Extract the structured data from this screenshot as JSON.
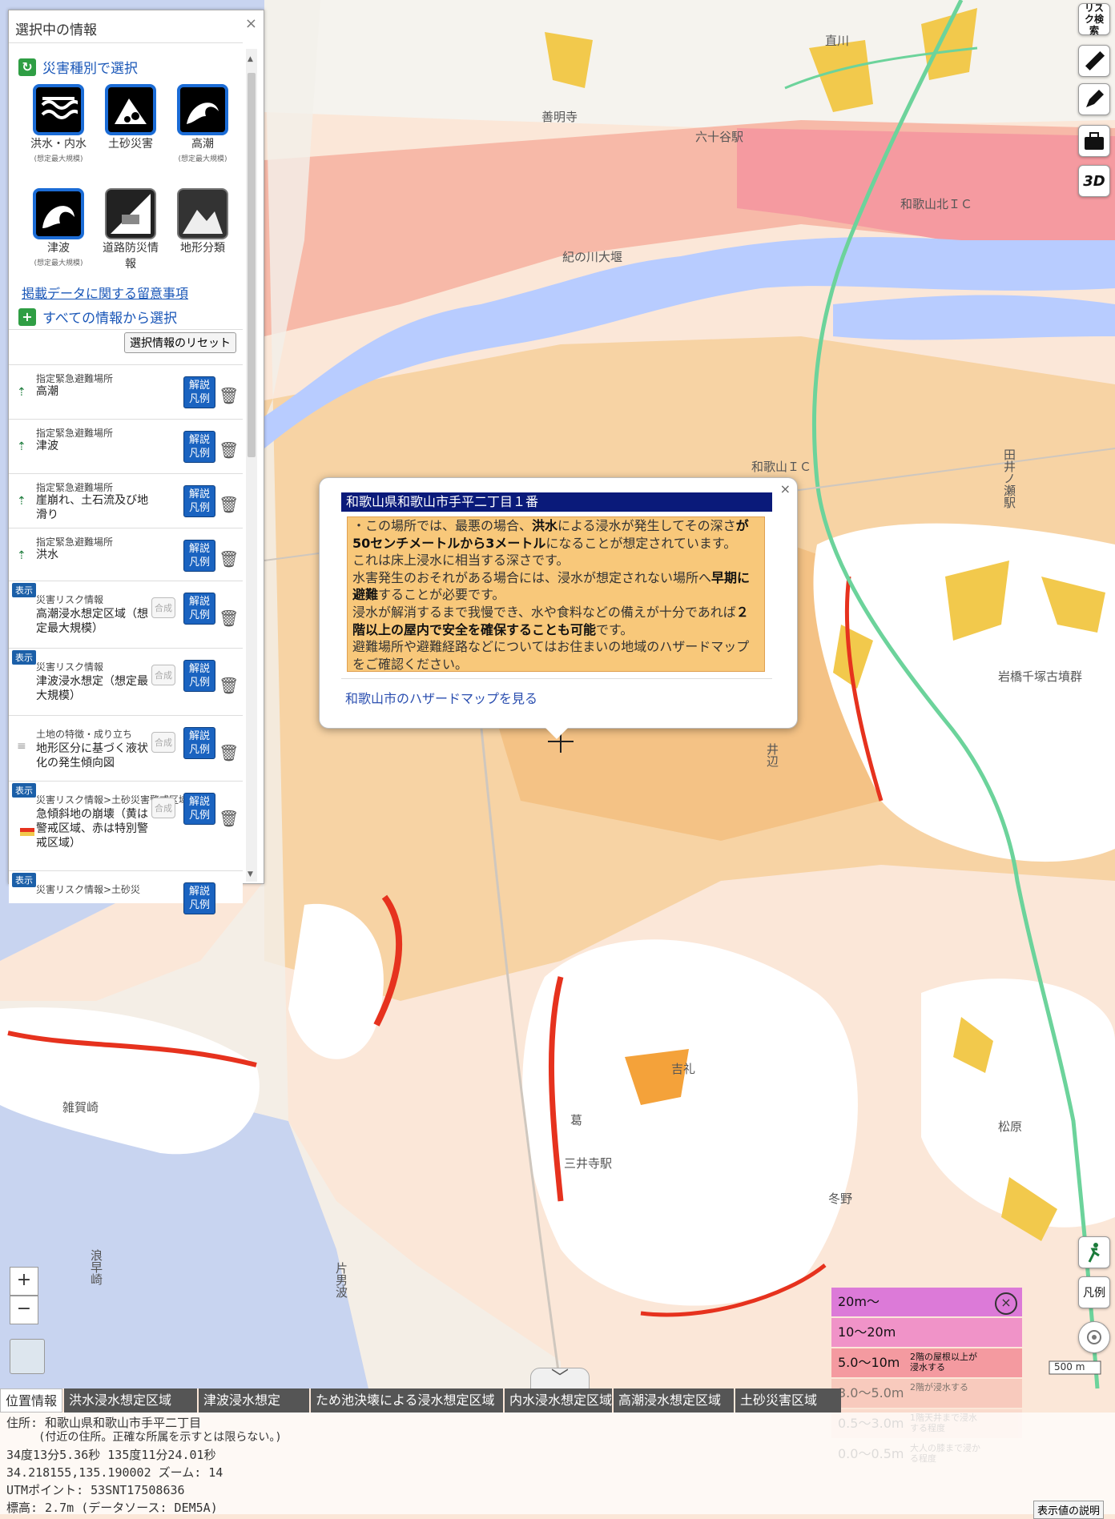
{
  "map": {
    "place_labels": [
      {
        "text": "直川"
      },
      {
        "text": "善明寺"
      },
      {
        "text": "六十谷駅"
      },
      {
        "text": "和歌山北ＩＣ"
      },
      {
        "text": "紀の川大堰"
      },
      {
        "text": "和歌山ＩＣ"
      },
      {
        "text": "岩橋千塚古墳群"
      },
      {
        "text": "吉礼"
      },
      {
        "text": "葛"
      },
      {
        "text": "三井寺駅"
      },
      {
        "text": "松原"
      },
      {
        "text": "冬野"
      },
      {
        "text": "雑賀崎"
      },
      {
        "text": "片男波"
      },
      {
        "text": "浪早崎"
      },
      {
        "text": "井辺"
      },
      {
        "text": "田井ノ瀬駅"
      }
    ],
    "scale_label": "500 m",
    "colors": {
      "base": "#fbe7d8",
      "flood_pink": "#f7b9a8",
      "flood_deep": "#f59aa0",
      "tsunami_yellow": "#f7e37a",
      "orange": "#f4b45c",
      "landslide_red": "#e6321e",
      "white_hill": "#ffffff",
      "river": "#b8ccff",
      "sea": "#c8d4f0",
      "expressway": "#6cd39b"
    }
  },
  "panel": {
    "title": "選択中の情報",
    "close": "×",
    "hazard_section": "災害種別で選択",
    "hazards": [
      {
        "label": "洪水・内水",
        "sub": "(想定最大規模)",
        "icon": "flood-icon"
      },
      {
        "label": "土砂災害",
        "sub": "",
        "icon": "landslide-icon"
      },
      {
        "label": "高潮",
        "sub": "(想定最大規模)",
        "icon": "storm-surge-icon"
      },
      {
        "label": "津波",
        "sub": "(想定最大規模)",
        "icon": "tsunami-icon"
      },
      {
        "label": "道路防災情報",
        "sub": "",
        "icon": "road-disaster-icon"
      },
      {
        "label": "地形分類",
        "sub": "",
        "icon": "terrain-icon"
      }
    ],
    "notes_link": "掲載データに関する留意事項",
    "all_info": "すべての情報から選択",
    "reset": "選択情報のリセット",
    "legend_btn_1": "解説",
    "legend_btn_2": "凡例",
    "merge_label": "合成",
    "show_badge": "表示",
    "items": [
      {
        "cat": "指定緊急避難場所",
        "name": "高潮"
      },
      {
        "cat": "指定緊急避難場所",
        "name": "津波"
      },
      {
        "cat": "指定緊急避難場所",
        "name": "崖崩れ、土石流及び地滑り"
      },
      {
        "cat": "指定緊急避難場所",
        "name": "洪水"
      },
      {
        "cat": "災害リスク情報",
        "name": "高潮浸水想定区域（想定最大規模）"
      },
      {
        "cat": "災害リスク情報",
        "name": "津波浸水想定（想定最大規模）"
      },
      {
        "cat": "土地の特徴・成り立ち",
        "name": "地形区分に基づく液状化の発生傾向図"
      },
      {
        "cat": "災害リスク情報>土砂災害警戒区域等",
        "name": "急傾斜地の崩壊（黄は警戒区域、赤は特別警戒区域）"
      },
      {
        "cat": "災害リスク情報>土砂災",
        "name": ""
      }
    ]
  },
  "popup": {
    "address": "和歌山県和歌山市手平二丁目１番",
    "close": "×",
    "lines": [
      "・この場所では、最悪の場合、洪水による浸水が発生してその深さが50センチメートルから3メートルになることが想定されています。",
      "これは床上浸水に相当する深さです。",
      "水害発生のおそれがある場合には、浸水が想定されない場所へ早期に避難することが必要です。",
      "浸水が解消するまで我慢でき、水や食料などの備えが十分であれば２階以上の屋内で安全を確保することも可能です。",
      "避難場所や避難経路などについてはお住まいの地域のハザードマップをご確認ください。"
    ],
    "link": "和歌山市のハザードマップを見る"
  },
  "toolbar": {
    "risk_search": "リスク検索",
    "ruler": "ruler-icon",
    "pencil": "pencil-icon",
    "toolbox": "toolbox-icon",
    "threed": "3D",
    "evacuate": "evacuate-icon",
    "legend": "凡例",
    "locate": "locate-icon"
  },
  "zoom": {
    "in": "+",
    "out": "−"
  },
  "tabs": [
    "位置情報",
    "洪水浸水想定区域",
    "津波浸水想定",
    "ため池決壊による浸水想定区域",
    "内水浸水想定区域",
    "高潮浸水想定区域",
    "土砂災害区域"
  ],
  "bottom": {
    "address": "住所: 和歌山県和歌山市手平二丁目",
    "address_note": "(付近の住所。正確な所属を示すとは限らない。)",
    "dms": "34度13分5.36秒 135度11分24.01秒",
    "decimal": "34.218155,135.190002  ズーム: 14",
    "utm": "UTMポイント: 53SNT17508636",
    "elev": "標高: 2.7m (データソース: DEM5A)",
    "value_note": "表示値の説明"
  },
  "legend": {
    "rows": [
      {
        "label": "20m〜",
        "note": "",
        "color": "#dc7ad8"
      },
      {
        "label": "10〜20m",
        "note": "",
        "color": "#f093c8"
      },
      {
        "label": "5.0〜10m",
        "note": "2階の屋根以上が浸水する",
        "color": "#f49aa0"
      },
      {
        "label": "3.0〜5.0m",
        "note": "2階が浸水する",
        "color": "#f6b3a8"
      },
      {
        "label": "0.5〜3.0m",
        "note": "1階天井まで浸水する程度",
        "color": "#f8d0c4"
      },
      {
        "label": "0.0〜0.5m",
        "note": "大人の膝まで浸かる程度",
        "color": "#fbe5d6"
      }
    ]
  }
}
